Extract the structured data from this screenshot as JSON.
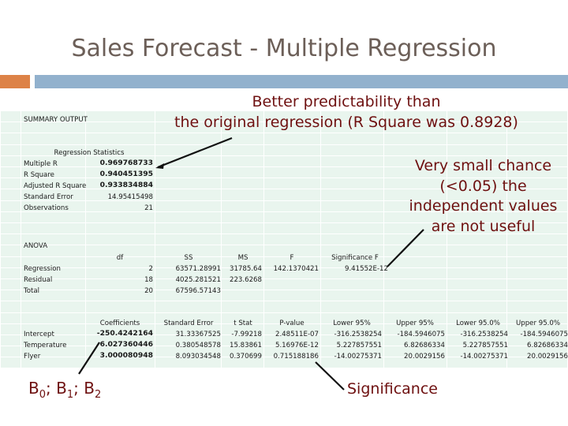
{
  "slide": {
    "title": "Sales Forecast - Multiple Regression",
    "accent_orange": "#dd8247",
    "accent_blue": "#92b1cd",
    "title_color": "#6c5f58",
    "callout_color": "#6e1010",
    "sheet_background": "#e9f5ee"
  },
  "callouts": {
    "top_line1": "Better predictability than",
    "top_line2": "the original regression (R Square was 0.8928)",
    "right": "Very small chance (<0.05) the independent values are not useful",
    "coefficients_label_b0": "B",
    "coefficients_label_b0_sub": "0",
    "coefficients_label_b1": "B",
    "coefficients_label_b1_sub": "1",
    "coefficients_label_b2": "B",
    "coefficients_label_b2_sub": "2",
    "coefficients_sep": "; ",
    "significance": "Significance"
  },
  "sheet": {
    "summary_output": "SUMMARY OUTPUT",
    "regression_statistics": {
      "header": "Regression Statistics",
      "rows": [
        {
          "label": "Multiple R",
          "value": "0.969768733",
          "bold": true
        },
        {
          "label": "R Square",
          "value": "0.940451395",
          "bold": true
        },
        {
          "label": "Adjusted R Square",
          "value": "0.933834884",
          "bold": true
        },
        {
          "label": "Standard Error",
          "value": "14.95415498",
          "bold": false
        },
        {
          "label": "Observations",
          "value": "21",
          "bold": false
        }
      ]
    },
    "anova": {
      "title": "ANOVA",
      "columns": [
        "df",
        "SS",
        "MS",
        "F",
        "Significance F"
      ],
      "rows": [
        {
          "label": "Regression",
          "df": "2",
          "ss": "63571.28991",
          "ms": "31785.64",
          "f": "142.1370421",
          "sig_f": "9.41552E-12"
        },
        {
          "label": "Residual",
          "df": "18",
          "ss": "4025.281521",
          "ms": "223.6268",
          "f": "",
          "sig_f": ""
        },
        {
          "label": "Total",
          "df": "20",
          "ss": "67596.57143",
          "ms": "",
          "f": "",
          "sig_f": ""
        }
      ]
    },
    "coefficients": {
      "columns": [
        "Coefficients",
        "Standard Error",
        "t Stat",
        "P-value",
        "Lower 95%",
        "Upper 95%",
        "Lower 95.0%",
        "Upper 95.0%"
      ],
      "rows": [
        {
          "label": "Intercept",
          "coef": "-250.4242164",
          "se": "31.33367525",
          "tstat": "-7.99218",
          "pvalue": "2.48511E-07",
          "lower95": "-316.2538254",
          "upper95": "-184.5946075",
          "lower950": "-316.2538254",
          "upper950": "-184.5946075"
        },
        {
          "label": "Temperature",
          "coef": "6.027360446",
          "se": "0.380548578",
          "tstat": "15.83861",
          "pvalue": "5.16976E-12",
          "lower95": "5.227857551",
          "upper95": "6.82686334",
          "lower950": "5.227857551",
          "upper950": "6.82686334"
        },
        {
          "label": "Flyer",
          "coef": "3.000080948",
          "se": "8.093034548",
          "tstat": "0.370699",
          "pvalue": "0.715188186",
          "lower95": "-14.00275371",
          "upper95": "20.0029156",
          "lower950": "-14.00275371",
          "upper950": "20.0029156"
        }
      ]
    }
  }
}
